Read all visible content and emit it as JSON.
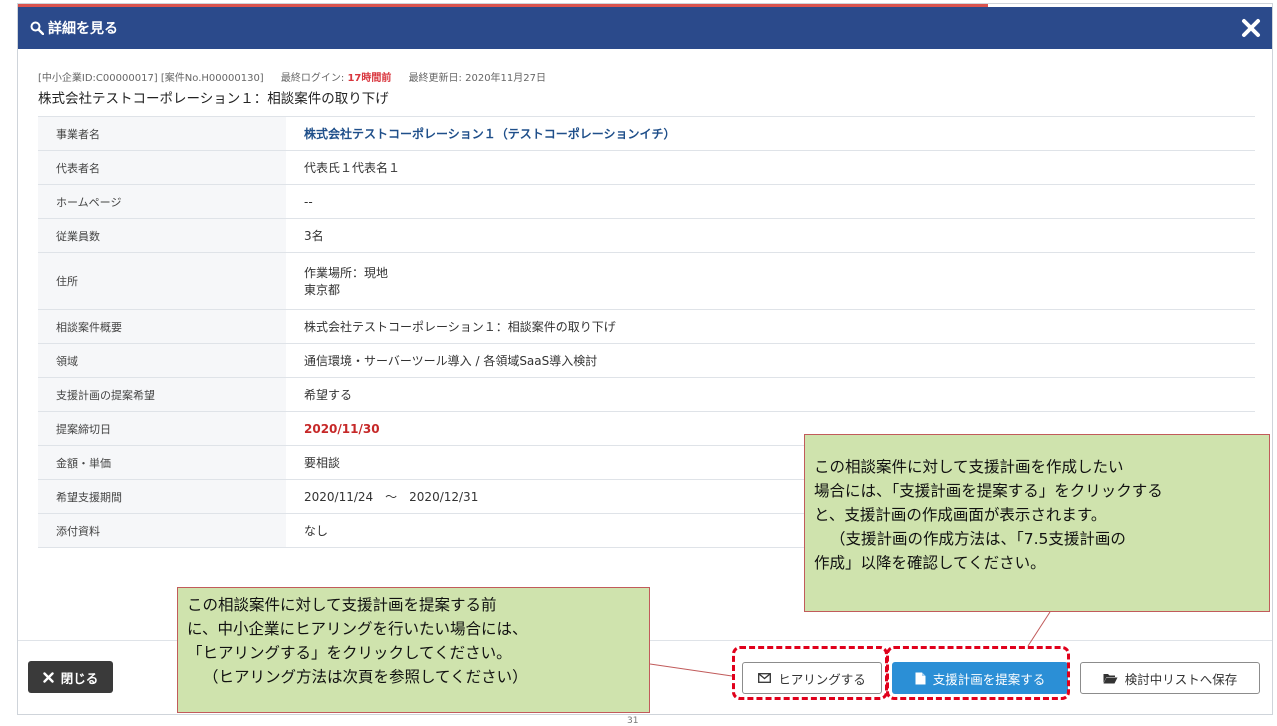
{
  "header": {
    "title": "詳細を見る"
  },
  "meta": {
    "ids": "[中小企業ID:C00000017] [案件No.H00000130]",
    "last_login_label": "最終ログイン:",
    "last_login_value": "17時間前",
    "last_updated": "最終更新日: 2020年11月27日"
  },
  "subject": "株式会社テストコーポレーション１：相談案件の取り下げ",
  "rows": [
    {
      "label": "事業者名",
      "value": "株式会社テストコーポレーション１（テストコーポレーションイチ）"
    },
    {
      "label": "代表者名",
      "value": "代表氏１代表名１"
    },
    {
      "label": "ホームページ",
      "value": "--"
    },
    {
      "label": "従業員数",
      "value": "3名"
    },
    {
      "label": "住所",
      "value_line1": "作業場所：現地",
      "value_line2": "東京都"
    },
    {
      "label": "相談案件概要",
      "value": "株式会社テストコーポレーション１：相談案件の取り下げ"
    },
    {
      "label": "領域",
      "value": "通信環境・サーバーツール導入 / 各領域SaaS導入検討"
    },
    {
      "label": "支援計画の提案希望",
      "value": "希望する"
    },
    {
      "label": "提案締切日",
      "value": "2020/11/30"
    },
    {
      "label": "金額・単価",
      "value": "要相談"
    },
    {
      "label": "希望支援期間",
      "value": "2020/11/24　～　2020/12/31"
    },
    {
      "label": "添付資料",
      "value": "なし"
    }
  ],
  "buttons": {
    "close": "閉じる",
    "hearing": "ヒアリングする",
    "propose": "支援計画を提案する",
    "save": "検討中リストへ保存"
  },
  "callout_left": {
    "line1": "この相談案件に対して支援計画を提案する前",
    "line2": "に、中小企業にヒアリングを行いたい場合には、",
    "line3": "「ヒアリングする」をクリックしてください。",
    "line4": "（ヒアリング方法は次頁を参照してください）"
  },
  "callout_right": {
    "line1": "この相談案件に対して支援計画を作成したい",
    "line2": "場合には、「支援計画を提案する」をクリックする",
    "line3": "と、支援計画の作成画面が表示されます。",
    "line4": "（支援計画の作成方法は、「7.5支援計画の",
    "line5": "作成」以降を確認してください。"
  },
  "page_number": "31",
  "colors": {
    "header": "#2b4a8b",
    "accent_red": "#d9363e",
    "propose_button": "#2b8fd6",
    "callout_bg": "#cfe3ad"
  }
}
